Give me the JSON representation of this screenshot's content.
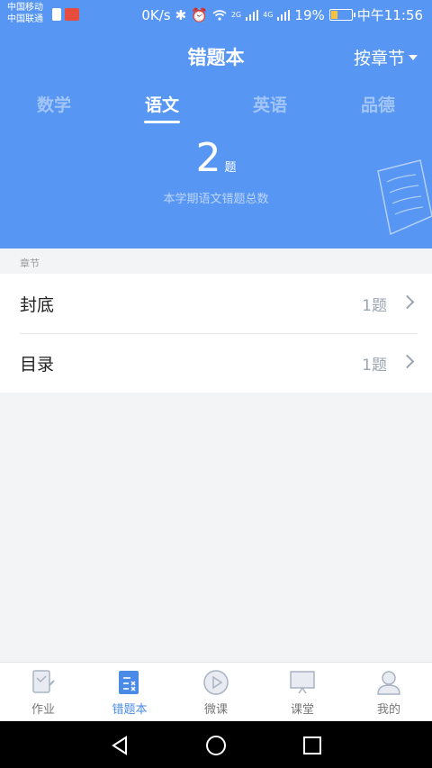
{
  "status_bar": {
    "carrier_1": "中国移动",
    "carrier_2": "中国联通",
    "speed": "0K/s",
    "signal_1": "2G",
    "signal_2": "4G",
    "battery": "19%",
    "time": "中午11:56"
  },
  "header": {
    "title": "错题本",
    "sort_label": "按章节"
  },
  "subject_tabs": [
    {
      "label": "数学",
      "active": false
    },
    {
      "label": "语文",
      "active": true
    },
    {
      "label": "英语",
      "active": false
    },
    {
      "label": "品德",
      "active": false
    }
  ],
  "summary": {
    "count": "2",
    "unit": "题",
    "label": "本学期语文错题总数"
  },
  "section_header": "章节",
  "chapters": [
    {
      "name": "封底",
      "count": "1题"
    },
    {
      "name": "目录",
      "count": "1题"
    }
  ],
  "bottom_tabs": [
    {
      "label": "作业",
      "icon": "homework-icon",
      "active": false
    },
    {
      "label": "错题本",
      "icon": "mistake-book-icon",
      "active": true
    },
    {
      "label": "微课",
      "icon": "play-icon",
      "active": false
    },
    {
      "label": "课堂",
      "icon": "classroom-icon",
      "active": false
    },
    {
      "label": "我的",
      "icon": "person-icon",
      "active": false
    }
  ],
  "colors": {
    "accent": "#5796f2",
    "active_tab": "#4a8be8"
  }
}
